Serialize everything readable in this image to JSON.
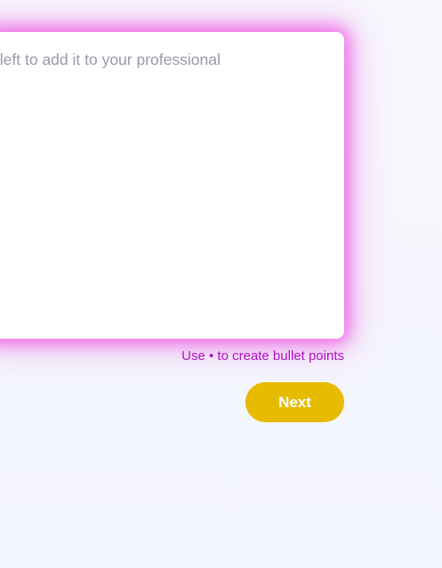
{
  "editor": {
    "text": "n the left to add it to your professional\nwn."
  },
  "hint": {
    "text": "Use • to create bullet points"
  },
  "actions": {
    "next_label": "Next"
  },
  "colors": {
    "glow": "#ee5ae6",
    "hint": "#b20fc6",
    "next_button": "#e6bb00"
  }
}
